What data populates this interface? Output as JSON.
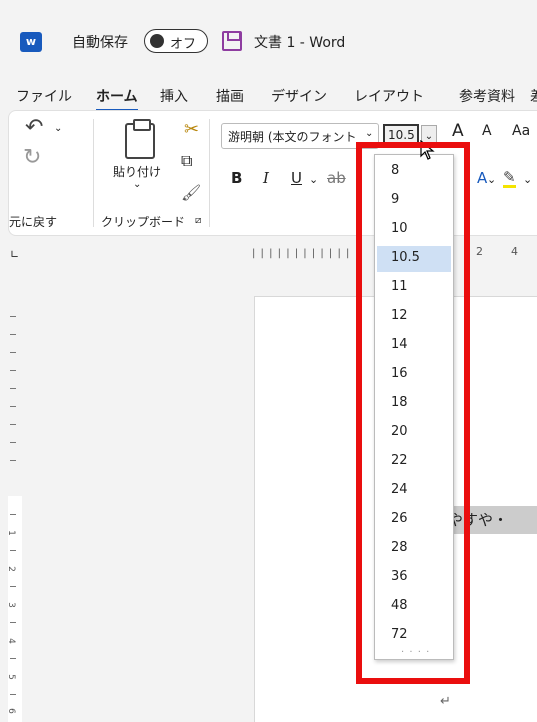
{
  "titlebar": {
    "logo_letter": "w",
    "autosave_label": "自動保存",
    "autosave_toggle": "オフ",
    "document_title": "文書 1  -  Word"
  },
  "menu": [
    "ファイル",
    "ホーム",
    "挿入",
    "描画",
    "デザイン",
    "レイアウト",
    "参考資料",
    "差"
  ],
  "menu_active": "ホーム",
  "ribbon": {
    "undo_group_label": "元に戻す",
    "clipboard_group_label": "クリップボード",
    "paste_label": "貼り付け",
    "font_name": "游明朝 (本文のフォント",
    "font_size": "10.5",
    "grow_font": "A",
    "shrink_font": "A",
    "change_case": "Aa",
    "bold": "B",
    "italic": "I",
    "underline": "U"
  },
  "ruler": {
    "numbers": [
      "2",
      "4"
    ]
  },
  "vertical_ruler_numbers": [
    "1",
    "2",
    "3",
    "4",
    "5",
    "6"
  ],
  "document": {
    "visible_text": "やすや・"
  },
  "font_size_dropdown": {
    "selected": "10.5",
    "options": [
      "8",
      "9",
      "10",
      "10.5",
      "11",
      "12",
      "14",
      "16",
      "18",
      "20",
      "22",
      "24",
      "26",
      "28",
      "36",
      "48",
      "72"
    ]
  },
  "colors": {
    "accent": "#185abd",
    "highlight_frame": "#ea0e0e",
    "selected_item": "#cfe0f4"
  }
}
